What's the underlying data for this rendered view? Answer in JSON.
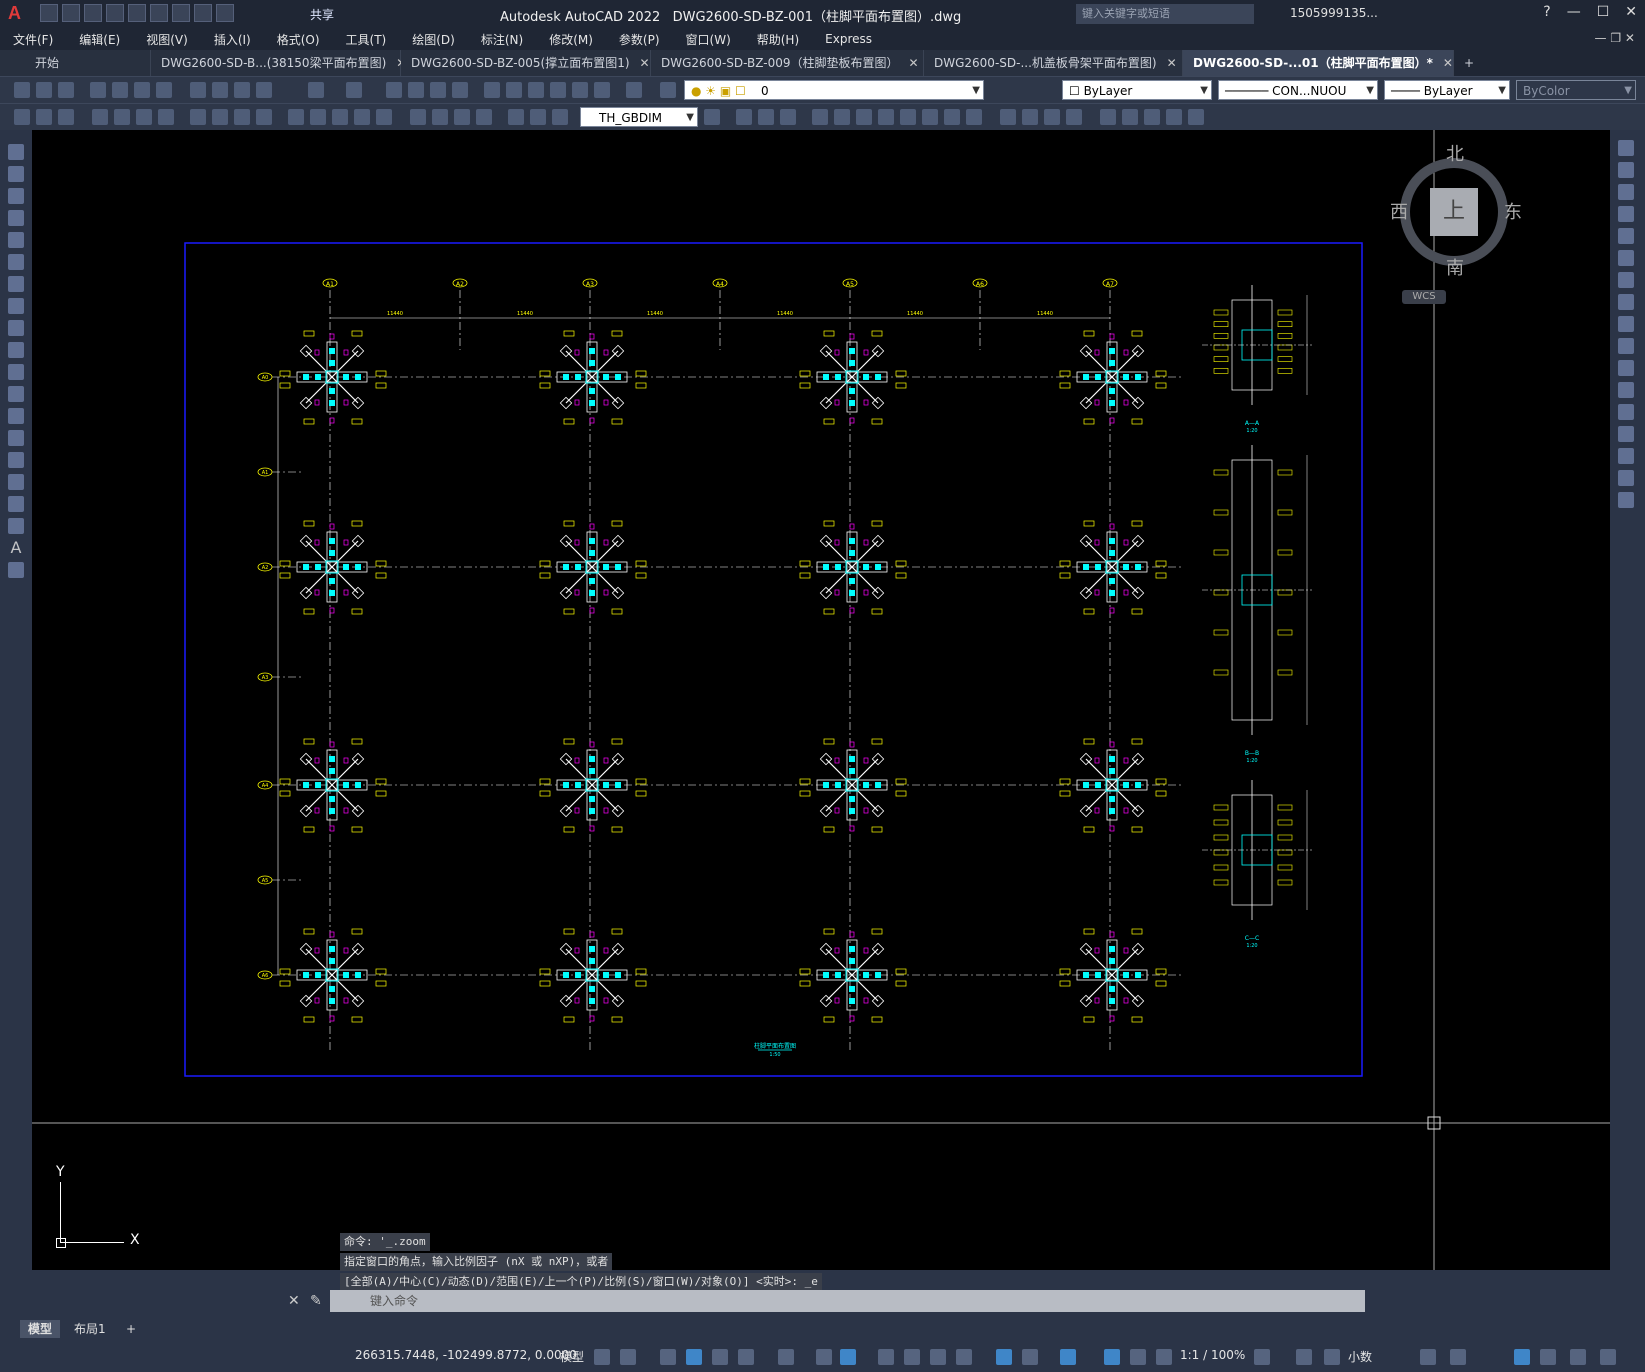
{
  "app": {
    "title": "Autodesk AutoCAD 2022",
    "document": "DWG2600-SD-BZ-001（柱脚平面布置图）.dwg",
    "share_label": "共享",
    "search_placeholder": "键入关键字或短语",
    "user": "1505999135...",
    "logo": "A"
  },
  "menu": [
    "文件(F)",
    "编辑(E)",
    "视图(V)",
    "插入(I)",
    "格式(O)",
    "工具(T)",
    "绘图(D)",
    "标注(N)",
    "修改(M)",
    "参数(P)",
    "窗口(W)",
    "帮助(H)",
    "Express"
  ],
  "tabs": [
    {
      "label": "开始",
      "active": false
    },
    {
      "label": "DWG2600-SD-B...(38150梁平面布置图)",
      "active": false
    },
    {
      "label": "DWG2600-SD-BZ-005(撑立面布置图1)",
      "active": false
    },
    {
      "label": "DWG2600-SD-BZ-009（柱脚垫板布置图）",
      "active": false
    },
    {
      "label": "DWG2600-SD-...机盖板骨架平面布置图)",
      "active": false
    },
    {
      "label": "DWG2600-SD-...01（柱脚平面布置图）*",
      "active": true
    }
  ],
  "toolbar": {
    "layer_value": "0",
    "color_value": "ByLayer",
    "linetype_value": "CON...NUOU",
    "lineweight_value": "ByLayer",
    "plotstyle_value": "ByColor",
    "dimstyle_value": "TH_GBDIM"
  },
  "viewcube": {
    "north": "北",
    "south": "南",
    "east": "东",
    "west": "西",
    "top": "上",
    "wcs": "WCS"
  },
  "drawing": {
    "grid_x": [
      "A1",
      "A2",
      "A3",
      "A4",
      "A5",
      "A6",
      "A7"
    ],
    "grid_y": [
      "A0",
      "A1",
      "A2",
      "A3",
      "A4",
      "A5",
      "A6"
    ],
    "spans": [
      "11440",
      "11440",
      "11440",
      "11440",
      "11440",
      "11440"
    ],
    "plan_title": "柱脚平面布置图",
    "plan_scale": "1:50",
    "sections": [
      {
        "title": "A—A",
        "scale": "1:20"
      },
      {
        "title": "B—B",
        "scale": "1:20"
      },
      {
        "title": "C—C",
        "scale": "1:20"
      }
    ]
  },
  "ucs": {
    "x": "X",
    "y": "Y"
  },
  "command": {
    "history": [
      "命令: '_.zoom",
      "指定窗口的角点，输入比例因子 (nX 或 nXP)，或者",
      "[全部(A)/中心(C)/动态(D)/范围(E)/上一个(P)/比例(S)/窗口(W)/对象(O)] <实时>: _e"
    ],
    "placeholder": "键入命令"
  },
  "layout_tabs": [
    "模型",
    "布局1",
    "+"
  ],
  "status": {
    "coords": "266315.7448, -102499.8772, 0.0000",
    "space": "模型",
    "scale": "1:1 / 100%",
    "units": "小数"
  },
  "colors": {
    "plan_frame": "#1a1aff",
    "mark_yellow": "#ffff00",
    "mark_cyan": "#00ffff",
    "mark_magenta": "#ff00ff",
    "line_white": "#ffffff"
  }
}
